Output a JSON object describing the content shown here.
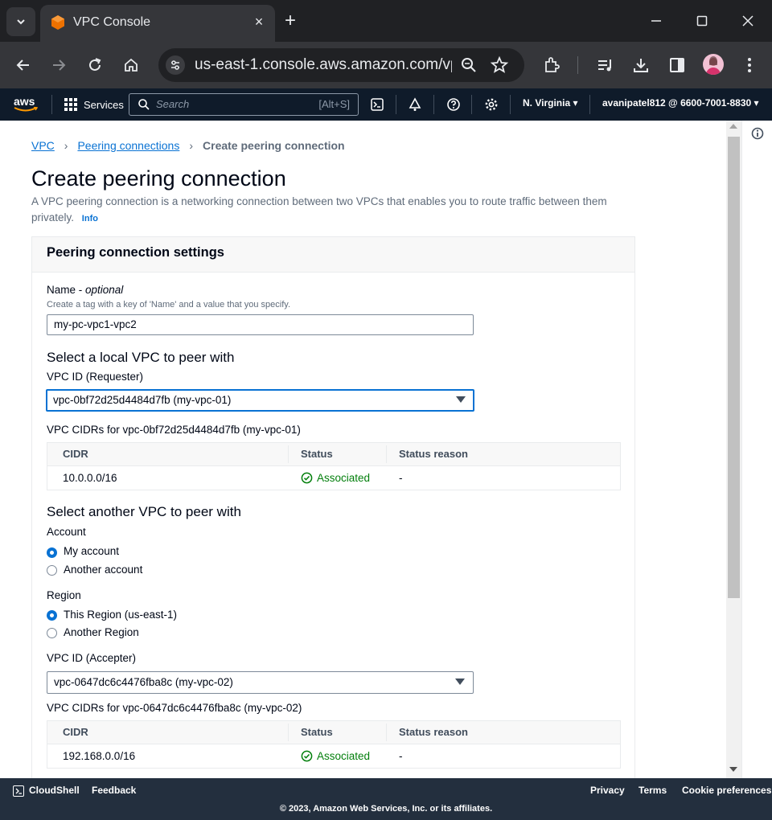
{
  "browser": {
    "tab_title": "VPC Console",
    "url": "us-east-1.console.aws.amazon.com/vpc...",
    "close_glyph": "×",
    "newtab_glyph": "+"
  },
  "aws_nav": {
    "logo_text": "aws",
    "services_label": "Services",
    "search_placeholder": "Search",
    "search_shortcut": "[Alt+S]",
    "region": "N. Virginia ▾",
    "account": "avanipatel812 @ 6600-7001-8830 ▾"
  },
  "breadcrumb": {
    "items": [
      "VPC",
      "Peering connections"
    ],
    "current": "Create peering connection",
    "separator": "›"
  },
  "page": {
    "title": "Create peering connection",
    "description": "A VPC peering connection is a networking connection between two VPCs that enables you to route traffic between them privately.",
    "info_link": "Info"
  },
  "settings": {
    "header": "Peering connection settings",
    "name_label": "Name",
    "name_optional": "optional",
    "name_hint": "Create a tag with a key of 'Name' and a value that you specify.",
    "name_value": "my-pc-vpc1-vpc2",
    "local_heading": "Select a local VPC to peer with",
    "requester_label": "VPC ID (Requester)",
    "requester_value": "vpc-0bf72d25d4484d7fb (my-vpc-01)",
    "requester_cidr_title": "VPC CIDRs for vpc-0bf72d25d4484d7fb (my-vpc-01)",
    "cidr_columns": [
      "CIDR",
      "Status",
      "Status reason"
    ],
    "requester_rows": [
      {
        "cidr": "10.0.0.0/16",
        "status": "Associated",
        "reason": "-"
      }
    ],
    "another_heading": "Select another VPC to peer with",
    "account_label": "Account",
    "account_options": [
      "My account",
      "Another account"
    ],
    "account_selected": 0,
    "region_label": "Region",
    "region_options": [
      "This Region (us-east-1)",
      "Another Region"
    ],
    "region_selected": 0,
    "accepter_label": "VPC ID (Accepter)",
    "accepter_value": "vpc-0647dc6c4476fba8c (my-vpc-02)",
    "accepter_cidr_title": "VPC CIDRs for vpc-0647dc6c4476fba8c (my-vpc-02)",
    "accepter_rows": [
      {
        "cidr": "192.168.0.0/16",
        "status": "Associated",
        "reason": "-"
      }
    ]
  },
  "footer": {
    "cloudshell": "CloudShell",
    "feedback": "Feedback",
    "privacy": "Privacy",
    "terms": "Terms",
    "cookies": "Cookie preferences",
    "copyright": "© 2023, Amazon Web Services, Inc. or its affiliates."
  },
  "colors": {
    "link": "#0972d3",
    "success": "#037f0c",
    "aws_nav_bg": "#0f1b2a",
    "footer_bg": "#232f3e"
  }
}
